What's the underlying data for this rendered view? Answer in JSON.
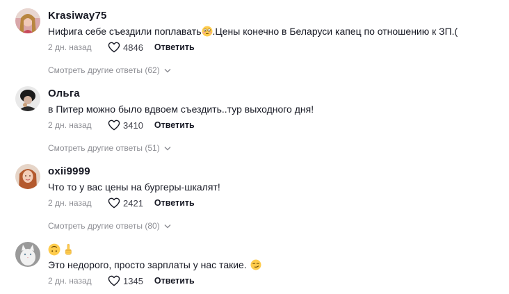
{
  "comments": [
    {
      "username": "Krasiway75",
      "text": "Нифига себе съездили поплавать",
      "text_after_emoji": ".Цены конечно в Беларуси капец по отношению к ЗП.(",
      "emoji": "flushed-face",
      "time": "2 дн. назад",
      "likes": "4846",
      "reply_label": "Ответить",
      "more_replies": "Смотреть другие ответы (62)"
    },
    {
      "username": "Ольга",
      "text": "в Питер можно было вдвоем съездить..тур выходного дня!",
      "time": "2 дн. назад",
      "likes": "3410",
      "reply_label": "Ответить",
      "more_replies": "Смотреть другие ответы (51)"
    },
    {
      "username": "oxii9999",
      "text": "Что то у вас цены на бургеры-шкалят!",
      "time": "2 дн. назад",
      "likes": "2421",
      "reply_label": "Ответить",
      "more_replies": "Смотреть другие ответы (80)"
    },
    {
      "username_emojis": [
        "upside-down-face",
        "index-pointing-up"
      ],
      "text": "Это недорого, просто зарплаты у нас такие.",
      "emoji": "smirking-face",
      "time": "2 дн. назад",
      "likes": "1345",
      "reply_label": "Ответить"
    }
  ],
  "icons": {
    "like": "heart-outline-icon",
    "expand": "chevron-down-icon"
  }
}
